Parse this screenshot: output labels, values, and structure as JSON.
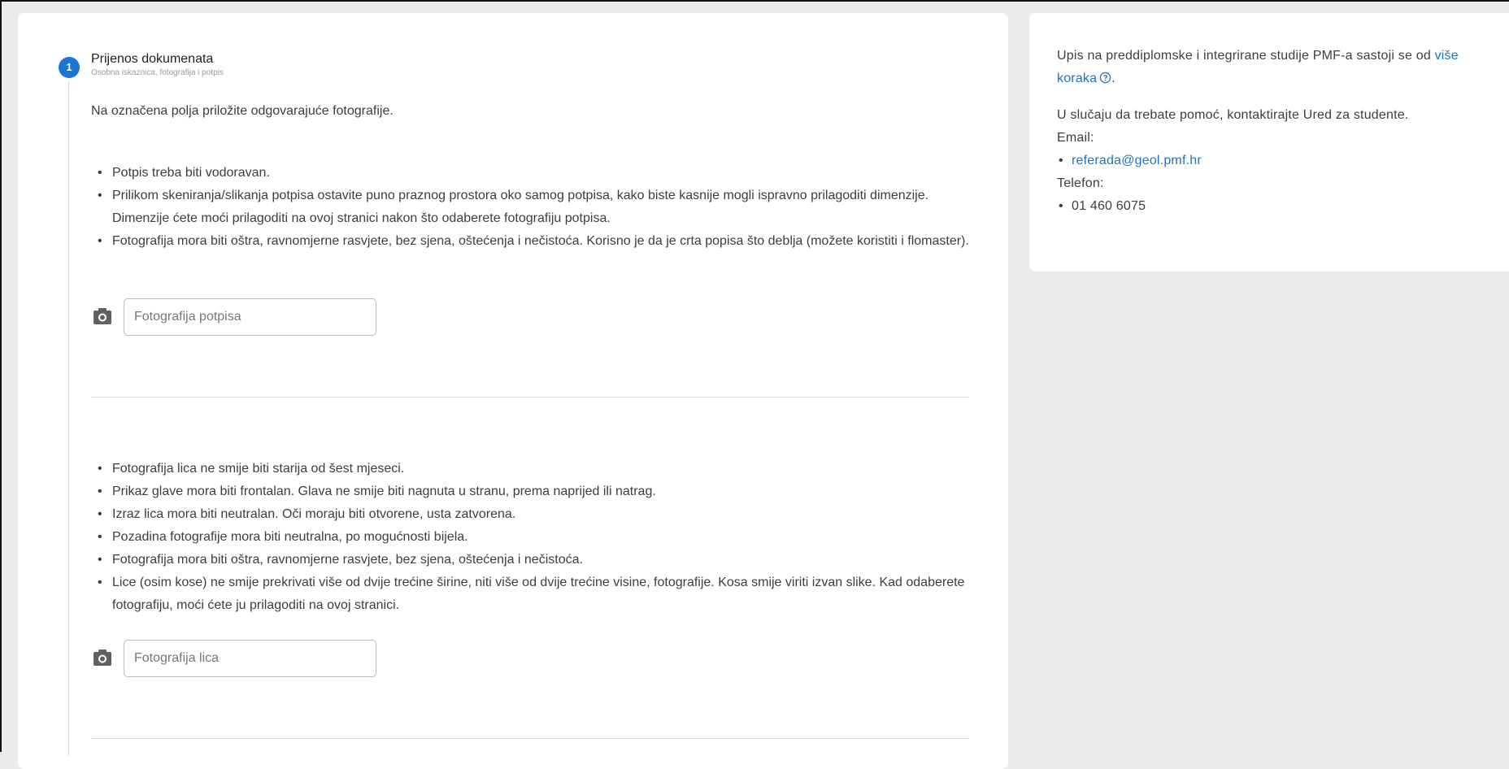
{
  "step": {
    "number": "1",
    "title": "Prijenos dokumenata",
    "subtitle": "Osobna iskaznica, fotografija i potpis"
  },
  "intro_text": "Na označena polja priložite odgovarajuće fotografije.",
  "signature_section": {
    "rules": [
      "Potpis treba biti vodoravan.",
      "Prilikom skeniranja/slikanja potpisa ostavite puno praznog prostora oko samog potpisa, kako biste kasnije mogli ispravno prilagoditi dimenzije. Dimenzije ćete moći prilagoditi na ovoj stranici nakon što odaberete fotografiju potpisa.",
      "Fotografija mora biti oštra, ravnomjerne rasvjete, bez sjena, oštećenja i nečistoća. Korisno je da je crta popisa što deblja (možete koristiti i flomaster)."
    ],
    "upload_placeholder": "Fotografija potpisa",
    "upload_icon": "camera-icon"
  },
  "face_section": {
    "rules": [
      "Fotografija lica ne smije biti starija od šest mjeseci.",
      "Prikaz glave mora biti frontalan. Glava ne smije biti nagnuta u stranu, prema naprijed ili natrag.",
      "Izraz lica mora biti neutralan. Oči moraju biti otvorene, usta zatvorena.",
      "Pozadina fotografije mora biti neutralna, po mogućnosti bijela.",
      "Fotografija mora biti oštra, ravnomjerne rasvjete, bez sjena, oštećenja i nečistoća.",
      "Lice (osim kose) ne smije prekrivati više od dvije trećine širine, niti više od dvije trećine visine, fotografije. Kosa smije viriti izvan slike. Kad odaberete fotografiju, moći ćete ju prilagoditi na ovoj stranici."
    ],
    "upload_placeholder": "Fotografija lica",
    "upload_icon": "camera-icon"
  },
  "sidebar": {
    "intro_prefix": "Upis na preddiplomske i integrirane studije PMF-a sastoji se od ",
    "intro_link": "više koraka",
    "intro_suffix": ".",
    "help_text": "U slučaju da trebate pomoć, kontaktirajte Ured za studente.",
    "email_label": "Email:",
    "email": "referada@geol.pmf.hr",
    "phone_label": "Telefon:",
    "phone": "01 460 6075"
  },
  "colors": {
    "accent": "#1976d2",
    "link": "#1e73be",
    "background": "#ebebeb"
  }
}
